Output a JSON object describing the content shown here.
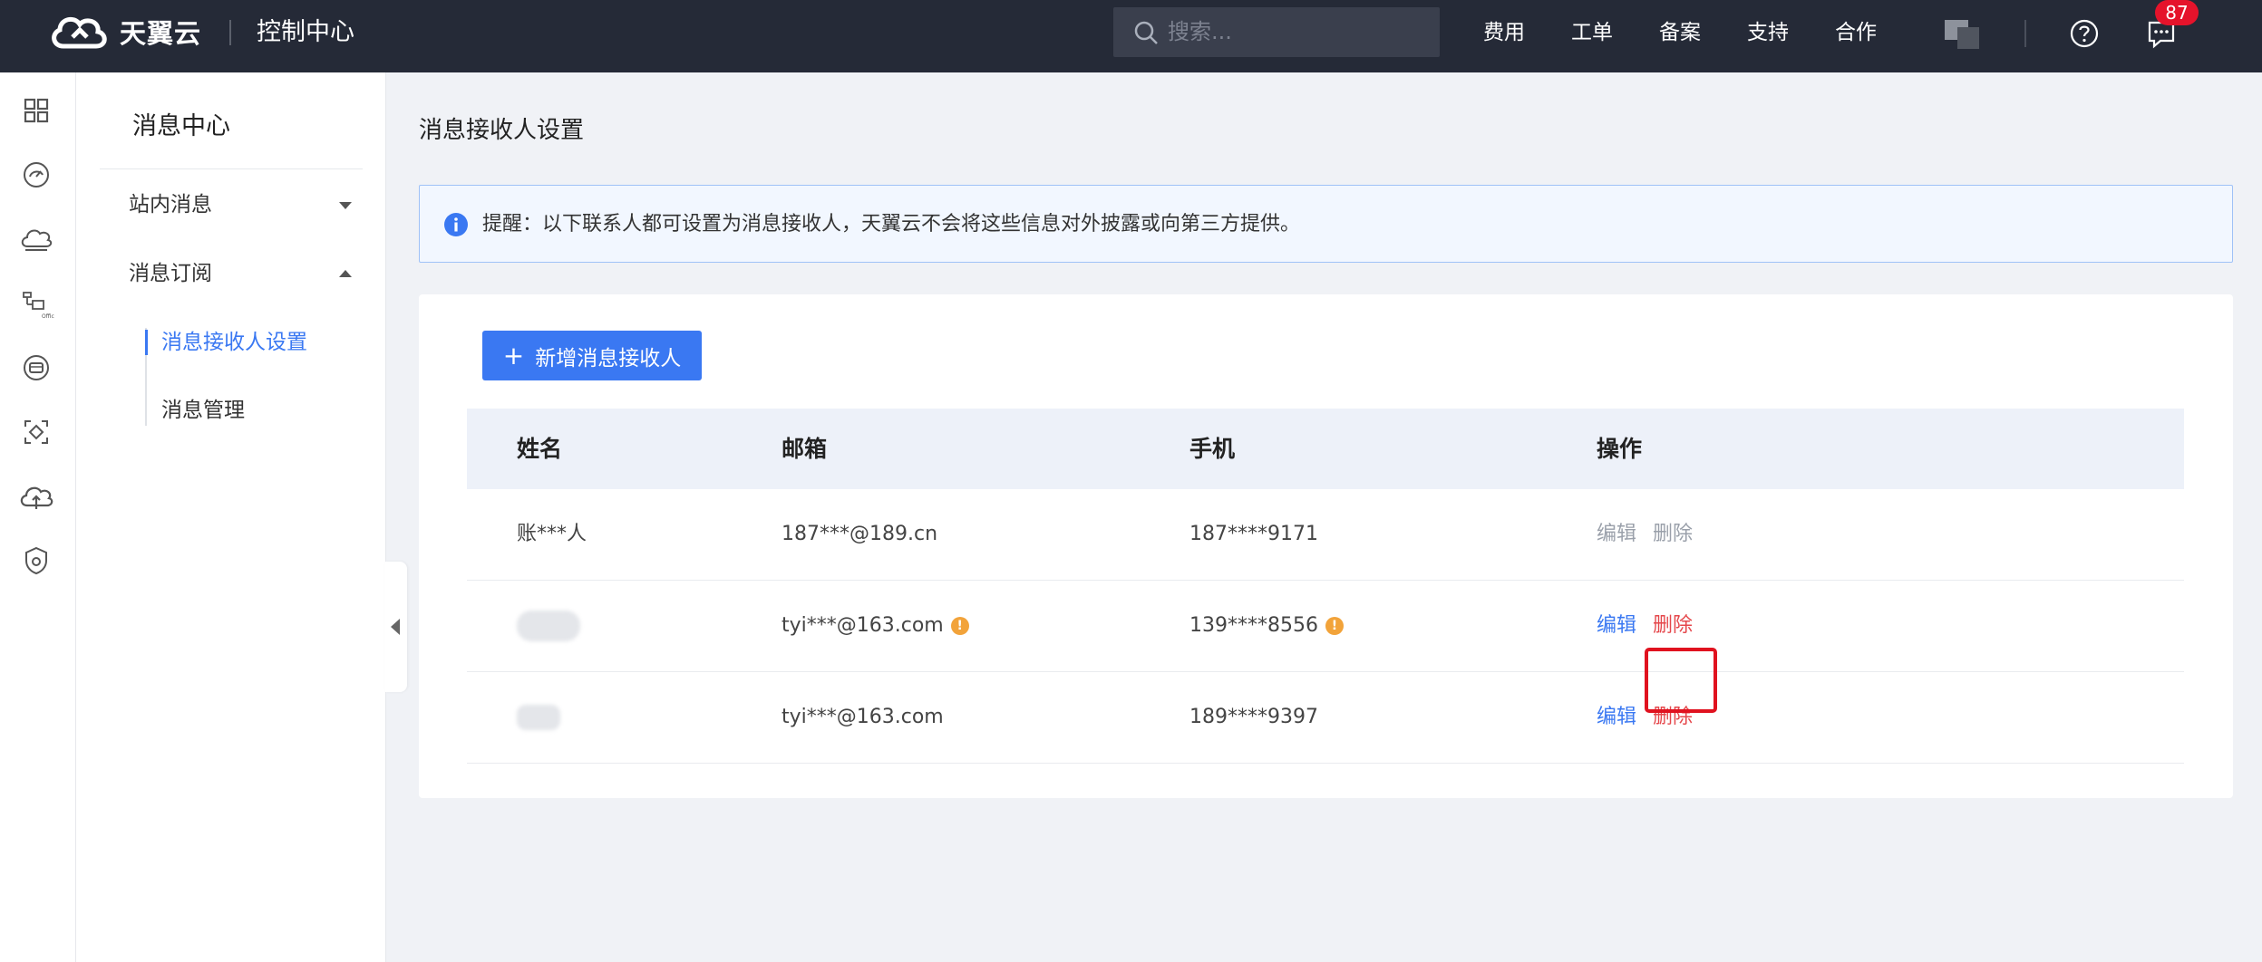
{
  "header": {
    "brand_name": "天翼云",
    "console_title": "控制中心",
    "search_placeholder": "搜索...",
    "nav": [
      "费用",
      "工单",
      "备案",
      "支持",
      "合作"
    ],
    "message_badge": "87"
  },
  "rail": {
    "icons": [
      "grid-icon",
      "dashboard-icon",
      "cloud-icon",
      "network-icon",
      "storage-icon",
      "scan-icon",
      "cloud-upload-icon",
      "shield-icon"
    ]
  },
  "subnav": {
    "title": "消息中心",
    "groups": [
      {
        "label": "站内消息",
        "expanded": false
      },
      {
        "label": "消息订阅",
        "expanded": true,
        "items": [
          {
            "label": "消息接收人设置",
            "active": true
          },
          {
            "label": "消息管理",
            "active": false
          }
        ]
      }
    ]
  },
  "main": {
    "page_title": "消息接收人设置",
    "notice": "提醒：以下联系人都可设置为消息接收人，天翼云不会将这些信息对外披露或向第三方提供。",
    "add_button_label": "新增消息接收人",
    "table": {
      "columns": [
        "姓名",
        "邮箱",
        "手机",
        "操作"
      ],
      "rows": [
        {
          "name": "账***人",
          "email": "187***@189.cn",
          "phone": "187****9171",
          "edit": "编辑",
          "delete": "删除",
          "enabled": false
        },
        {
          "name": "",
          "email": "tyi***@163.com",
          "phone": "139****8556",
          "edit": "编辑",
          "delete": "删除",
          "enabled": true
        },
        {
          "name": "",
          "email": "tyi***@163.com",
          "phone": "189****9397",
          "edit": "编辑",
          "delete": "删除",
          "enabled": true
        }
      ]
    }
  },
  "colors": {
    "topbar": "#252a37",
    "accent": "#3a78f2",
    "danger": "#e5474b",
    "highlight": "#e0121f",
    "warning": "#f2a33a"
  }
}
